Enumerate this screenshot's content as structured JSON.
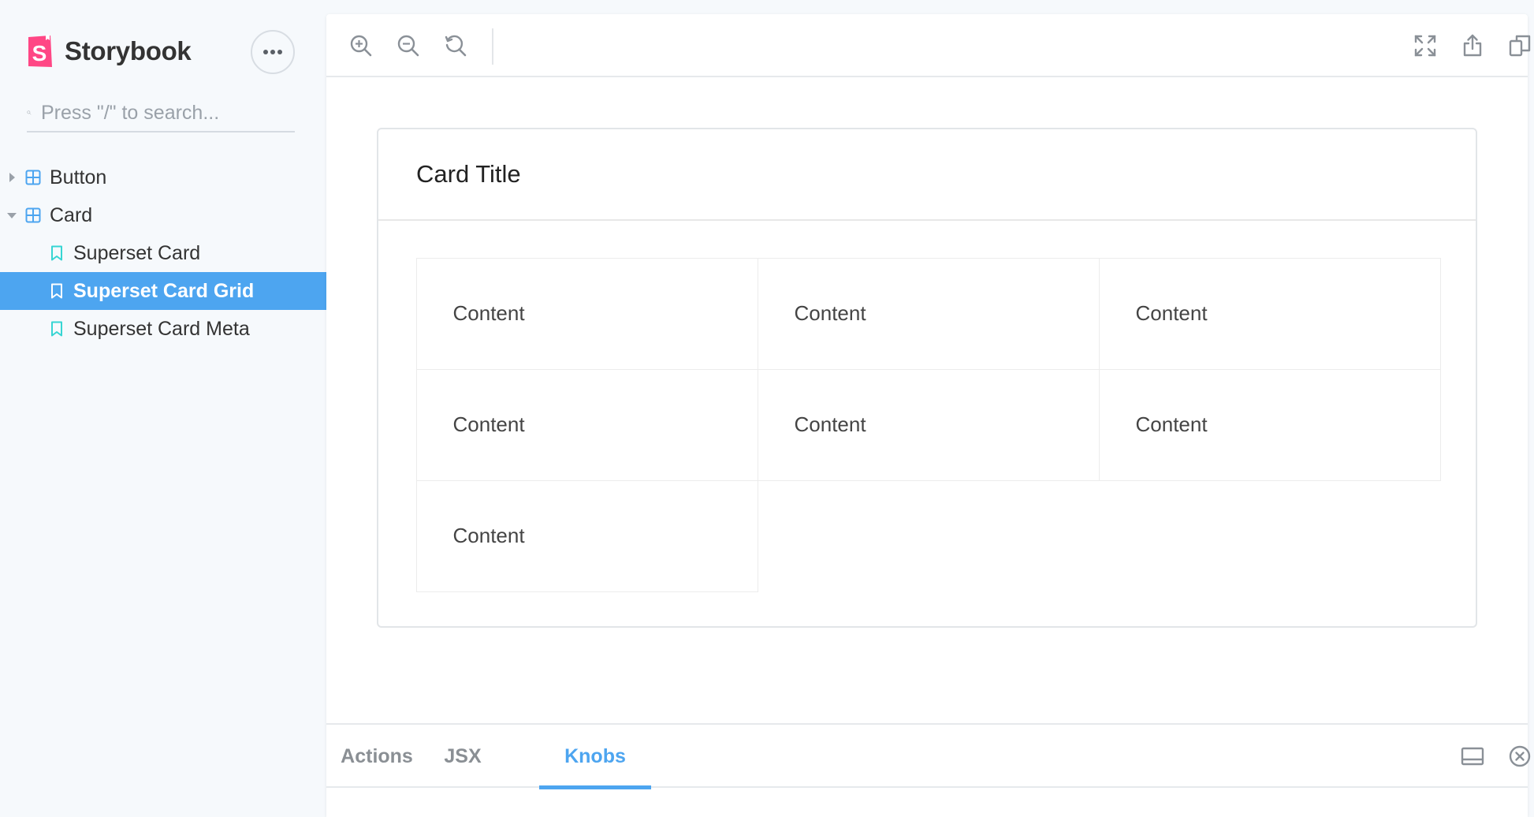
{
  "sidebar": {
    "brand": "Storybook",
    "brand_logo_letter": "S",
    "menu_icon": "ellipsis-icon",
    "search": {
      "placeholder": "Press \"/\" to search...",
      "value": ""
    },
    "tree": [
      {
        "type": "component",
        "label": "Button",
        "expanded": false
      },
      {
        "type": "component",
        "label": "Card",
        "expanded": true
      },
      {
        "type": "story",
        "label": "Superset Card",
        "selected": false
      },
      {
        "type": "story",
        "label": "Superset Card Grid",
        "selected": true
      },
      {
        "type": "story",
        "label": "Superset Card Meta",
        "selected": false
      }
    ]
  },
  "toolbar": {
    "left_tools": [
      "zoom-in-icon",
      "zoom-out-icon",
      "reset-zoom-icon"
    ],
    "right_tools": [
      "fullscreen-icon",
      "share-icon",
      "copy-icon"
    ]
  },
  "preview": {
    "card": {
      "title": "Card Title",
      "cells": [
        "Content",
        "Content",
        "Content",
        "Content",
        "Content",
        "Content",
        "Content"
      ]
    }
  },
  "addons": {
    "tabs": [
      {
        "label": "Actions",
        "active": false
      },
      {
        "label": "JSX",
        "active": false
      },
      {
        "label": "Knobs",
        "active": true
      }
    ],
    "tools": [
      "panel-layout-icon",
      "close-circle-icon"
    ]
  },
  "colors": {
    "accent": "#4da5f0",
    "brand": "#ff4785",
    "sidebar_bg": "#f6f9fc",
    "story_icon": "#37d5d3"
  }
}
